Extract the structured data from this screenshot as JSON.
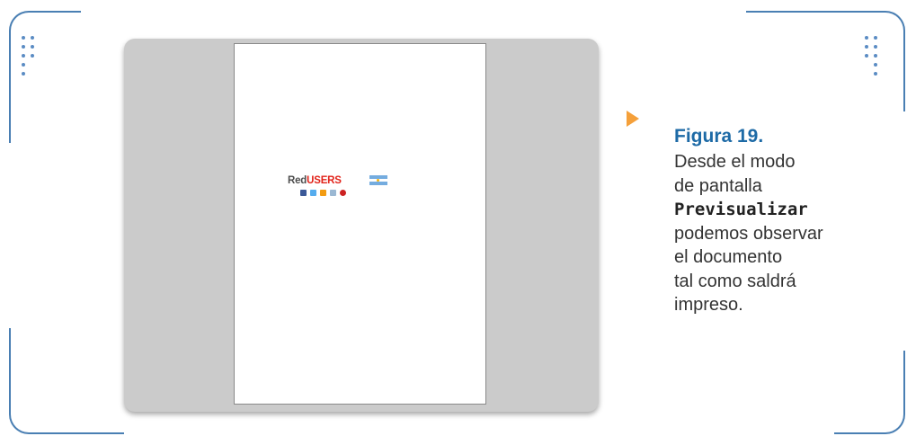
{
  "caption": {
    "figure_label": "Figura 19.",
    "lines": [
      "Desde el modo",
      "de pantalla",
      "Previsualizar",
      "podemos observar",
      "el documento",
      "tal como saldrá",
      "impreso."
    ]
  },
  "preview": {
    "logo_part1": "Red",
    "logo_part2": "USERS"
  },
  "colors": {
    "frame": "#4a7fb3",
    "figure_label": "#1d6aa6",
    "arrow": "#f5a03a",
    "preview_background": "#cbcbcb",
    "logo_red": "#e2231a"
  },
  "icons": [
    "grid-dots-icon",
    "caption-arrow-icon",
    "argentina-flag-icon",
    "social-icons"
  ]
}
